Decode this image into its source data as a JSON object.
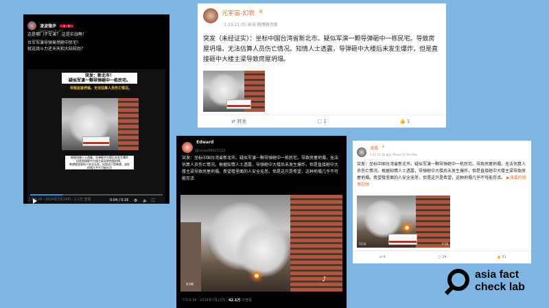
{
  "post1": {
    "username": "凌波微步",
    "handle": "@lnbowei5u07",
    "text_line1": "这是哪门子军演？ 这是实战啊！",
    "text_line2": "台军军演导弹竟然砸中民宅！",
    "text_line3": "就这战斗力还天天和大陆较劲？",
    "caption_title": "突发：新北市！",
    "caption_sub": "疑似军演一颗导弹砸中一栋民宅。",
    "caption_red": "导致房屋坍塌，无法估算人员伤亡情况。",
    "subtitle1": "根据知情人士透露，导弹砸中大楼后未发生爆炸",
    "subtitle2": "但是直接砸中大楼主梁导致房屋坍塌，",
    "subtitle3": "希望楼里面的人安全无恙，但是这只是希望，这样",
    "subtitle4": "坍塌几乎不可能存活",
    "time": "0:04 / 0:16",
    "footer": "上午9:24 · 2024年7月24日 · 2.1万 查看"
  },
  "post2": {
    "username": "元宇宙-幻世",
    "meta": "7-23 21:05 来自 微博网页版",
    "text": "突发（未经证实）：坐标中国台湾省新北市。疑似军演一颗导弹砸中一栋民宅。导致房屋坍塌，无法估算人员伤亡情况。知情人士透露，导弹砸中大楼后未发生爆炸，但是直接砸中大楼主梁导致房屋坍塌。",
    "repost": "转发",
    "comments": "1",
    "likes": "1"
  },
  "post3": {
    "username": "Edward",
    "handle": "@tomjo66621523",
    "text": "突发：坐标中国台湾省新北市。疑似军演一颗导弹砸中一栋民宅。导致房屋坍塌，无法估算人员伤亡情况。根据知情人士透露，导弹砸中大楼后未发生爆炸，但是直接砸中大楼主梁导致房屋坍塌。希望楼里面的人安全无恙，但是这只是希望，这种坍塌几乎不可能存活",
    "time": "0:06",
    "footer_time": "下午3:34 · 2024年7月23日 · ",
    "footer_views": "42.1万",
    "footer_views_label": " 次查看"
  },
  "post4": {
    "username": "涛葛",
    "meta": "7-23 15:18 来自 iPhone 15 Pro Max",
    "text": "突发：坐标中国台湾省新北市。疑似军演一颗导弹砸中一栋民宅。导致房屋坍塌，无法估算人员伤亡情况。根据知情人士透露，导弹砸中大楼后未发生爆炸，但是直接砸中大楼主梁导致房屋坍塌。希望楼里面的人安全无恙，但是这只是希望，这种坍塌几乎不可能存活。",
    "link": "涛葛的微博视频",
    "views": "3万次",
    "duration": "0:16",
    "reposts": "6",
    "comments": "24",
    "likes": "51"
  },
  "brand": {
    "line1": "asia fact",
    "line2": "check lab"
  }
}
